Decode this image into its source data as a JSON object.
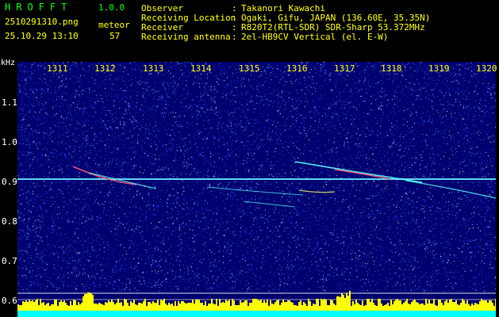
{
  "header": {
    "brand": "HROFFT",
    "version": "1.0.0",
    "filename": "2510291310.png",
    "category_label": "meteor",
    "timestamp": "25.10.29 13:10",
    "count": "57",
    "info": [
      {
        "key": "Observer",
        "sep": ":",
        "value": "Takanori Kawachi"
      },
      {
        "key": "Receiving Location",
        "sep": ":",
        "value": "Ogaki, Gifu, JAPAN (136.60E, 35.35N)"
      },
      {
        "key": "Receiver",
        "sep": ":",
        "value": "R820T2(RTL-SDR) SDR-Sharp 53.372MHz"
      },
      {
        "key": "Receiving antenna",
        "sep": ":",
        "value": "2el-HB9CV Vertical (el. E-W)"
      }
    ]
  },
  "axes": {
    "y_unit": "kHz",
    "y_ticks": [
      "1.1",
      "1.0",
      "0.9",
      "0.8",
      "0.7",
      "0.6"
    ],
    "x_ticks": [
      "1311",
      "1312",
      "1313",
      "1314",
      "1315",
      "1316",
      "1317",
      "1318",
      "1319",
      "1320"
    ]
  },
  "colors": {
    "background": "#000000",
    "spectrogram_bg": "#00006e",
    "label_text": "#ffff00",
    "brand_text": "#00ff00",
    "axis_text": "#ffffff",
    "signal": "#33ddff",
    "histogram_yellow": "#ffff00",
    "histogram_cyan": "#00ffff"
  }
}
